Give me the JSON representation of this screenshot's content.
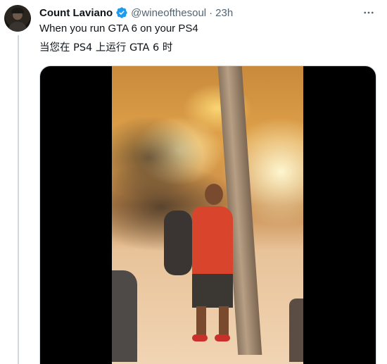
{
  "tweet": {
    "author_name": "Count Laviano",
    "handle": "@wineofthesoul",
    "separator": "·",
    "time": "23h",
    "verified": true,
    "text_line1": "When you run GTA 6 on your PS4",
    "text_line2": "当您在 PS4 上运行 GTA 6 时"
  },
  "icons": {
    "verified": "verified-badge-icon",
    "more": "more-options-icon"
  },
  "colors": {
    "verified_blue": "#1d9bf0",
    "secondary_text": "#536471",
    "border": "#cfd9de"
  }
}
